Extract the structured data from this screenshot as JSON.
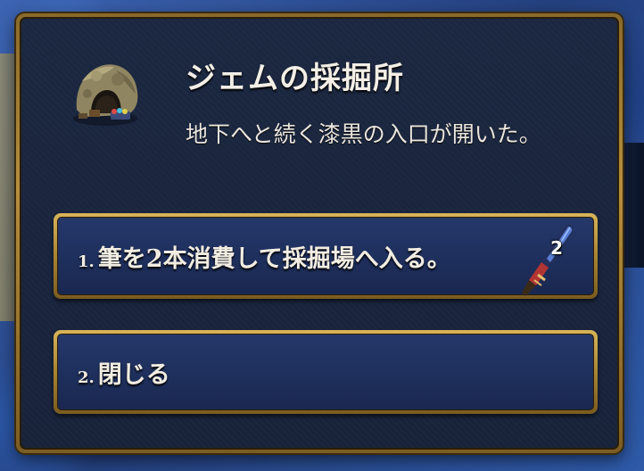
{
  "event": {
    "title": "ジェムの採掘所",
    "description": "地下へと続く漆黒の入口が開いた。",
    "icon": "gem-mine-icon"
  },
  "options": [
    {
      "number": "1.",
      "label": "筆を2本消費して採掘場へ入る。",
      "cost_icon": "brush-icon",
      "cost_count": "2"
    },
    {
      "number": "2.",
      "label": "閉じる"
    }
  ],
  "colors": {
    "frame_gold": "#b68e3e",
    "panel_bg": "#1b2740",
    "button_bg": "#22345f",
    "text": "#f2ede2"
  }
}
